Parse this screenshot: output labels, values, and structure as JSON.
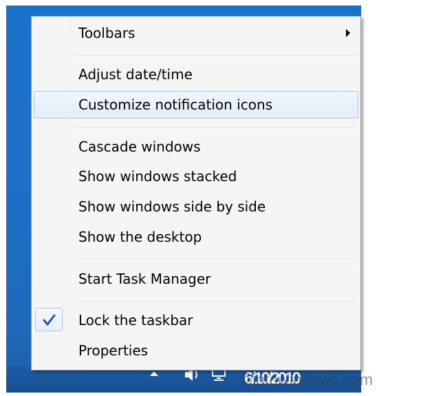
{
  "menu": {
    "items": [
      {
        "label": "Toolbars",
        "has_submenu": true,
        "icon": "chevron-right-icon"
      },
      {
        "label": "Adjust date/time"
      },
      {
        "label": "Customize notification icons",
        "highlighted": true
      },
      {
        "label": "Cascade windows"
      },
      {
        "label": "Show windows stacked"
      },
      {
        "label": "Show windows side by side"
      },
      {
        "label": "Show the desktop"
      },
      {
        "label": "Start Task Manager"
      },
      {
        "label": "Lock the taskbar",
        "checked": true,
        "icon": "checkmark-icon"
      },
      {
        "label": "Properties"
      }
    ]
  },
  "taskbar": {
    "clock_text": "6/10/2010",
    "icons": [
      "tray-arrow-icon",
      "volume-icon",
      "network-icon"
    ]
  },
  "watermark": {
    "text": "©intowindows.com"
  },
  "colors": {
    "desktop_blue": "#1d6fc5",
    "menu_bg": "#f5f5f5",
    "hover_border": "#a8c5e8",
    "checkmark": "#1c56b9"
  }
}
